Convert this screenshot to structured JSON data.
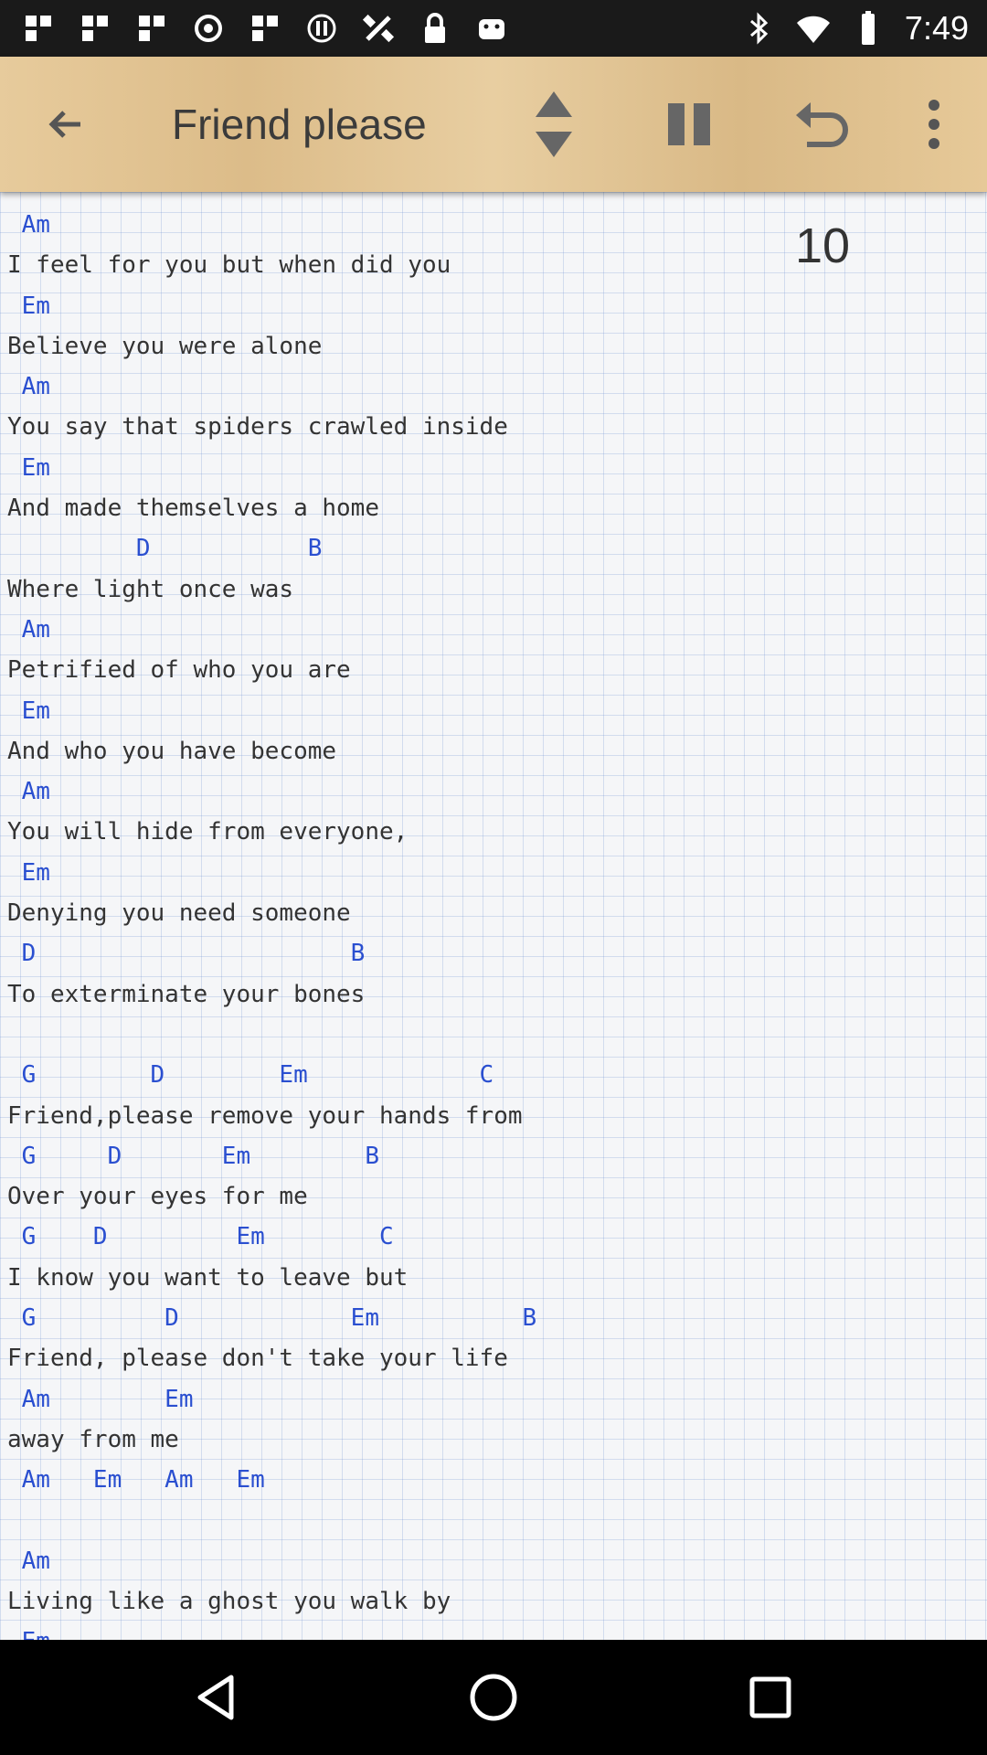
{
  "status_bar": {
    "time": "7:49",
    "icons": [
      "notification-icon",
      "notification-icon",
      "notification-icon",
      "record-icon",
      "notification-icon",
      "data-icon",
      "satellite-icon",
      "lock-icon",
      "android-icon",
      "bluetooth-icon",
      "wifi-icon",
      "battery-icon"
    ]
  },
  "toolbar": {
    "back_icon": "arrow-left-icon",
    "title": "Friend please",
    "scroll_icon": "up-down-arrows-icon",
    "pause_icon": "pause-icon",
    "undo_icon": "undo-icon",
    "more_icon": "more-vertical-icon"
  },
  "sheet": {
    "counter": "10",
    "lines": [
      {
        "type": "chord",
        "text": " Am"
      },
      {
        "type": "lyric",
        "text": "I feel for you but when did you"
      },
      {
        "type": "chord",
        "text": " Em"
      },
      {
        "type": "lyric",
        "text": "Believe you were alone"
      },
      {
        "type": "chord",
        "text": " Am"
      },
      {
        "type": "lyric",
        "text": "You say that spiders crawled inside"
      },
      {
        "type": "chord",
        "text": " Em"
      },
      {
        "type": "lyric",
        "text": "And made themselves a home"
      },
      {
        "type": "chord",
        "text": "         D           B"
      },
      {
        "type": "lyric",
        "text": "Where light once was"
      },
      {
        "type": "chord",
        "text": " Am"
      },
      {
        "type": "lyric",
        "text": "Petrified of who you are"
      },
      {
        "type": "chord",
        "text": " Em"
      },
      {
        "type": "lyric",
        "text": "And who you have become"
      },
      {
        "type": "chord",
        "text": " Am"
      },
      {
        "type": "lyric",
        "text": "You will hide from everyone,"
      },
      {
        "type": "chord",
        "text": " Em"
      },
      {
        "type": "lyric",
        "text": "Denying you need someone"
      },
      {
        "type": "chord",
        "text": " D                      B"
      },
      {
        "type": "lyric",
        "text": "To exterminate your bones"
      },
      {
        "type": "blank",
        "text": ""
      },
      {
        "type": "chord",
        "text": " G        D        Em            C"
      },
      {
        "type": "lyric",
        "text": "Friend,please remove your hands from"
      },
      {
        "type": "chord",
        "text": " G     D       Em        B"
      },
      {
        "type": "lyric",
        "text": "Over your eyes for me"
      },
      {
        "type": "chord",
        "text": " G    D         Em        C"
      },
      {
        "type": "lyric",
        "text": "I know you want to leave but"
      },
      {
        "type": "chord",
        "text": " G         D            Em          B"
      },
      {
        "type": "lyric",
        "text": "Friend, please don't take your life"
      },
      {
        "type": "chord",
        "text": " Am        Em"
      },
      {
        "type": "lyric",
        "text": "away from me"
      },
      {
        "type": "chord",
        "text": " Am   Em   Am   Em"
      },
      {
        "type": "blank",
        "text": ""
      },
      {
        "type": "chord",
        "text": " Am"
      },
      {
        "type": "lyric",
        "text": "Living like a ghost you walk by"
      },
      {
        "type": "chord",
        "text": " Em"
      }
    ]
  },
  "nav_bar": {
    "back_icon": "triangle-back-icon",
    "home_icon": "circle-home-icon",
    "recents_icon": "square-recents-icon"
  },
  "colors": {
    "chord": "#2a4fd0",
    "lyric": "#333333",
    "toolbar": "#e2c594"
  }
}
